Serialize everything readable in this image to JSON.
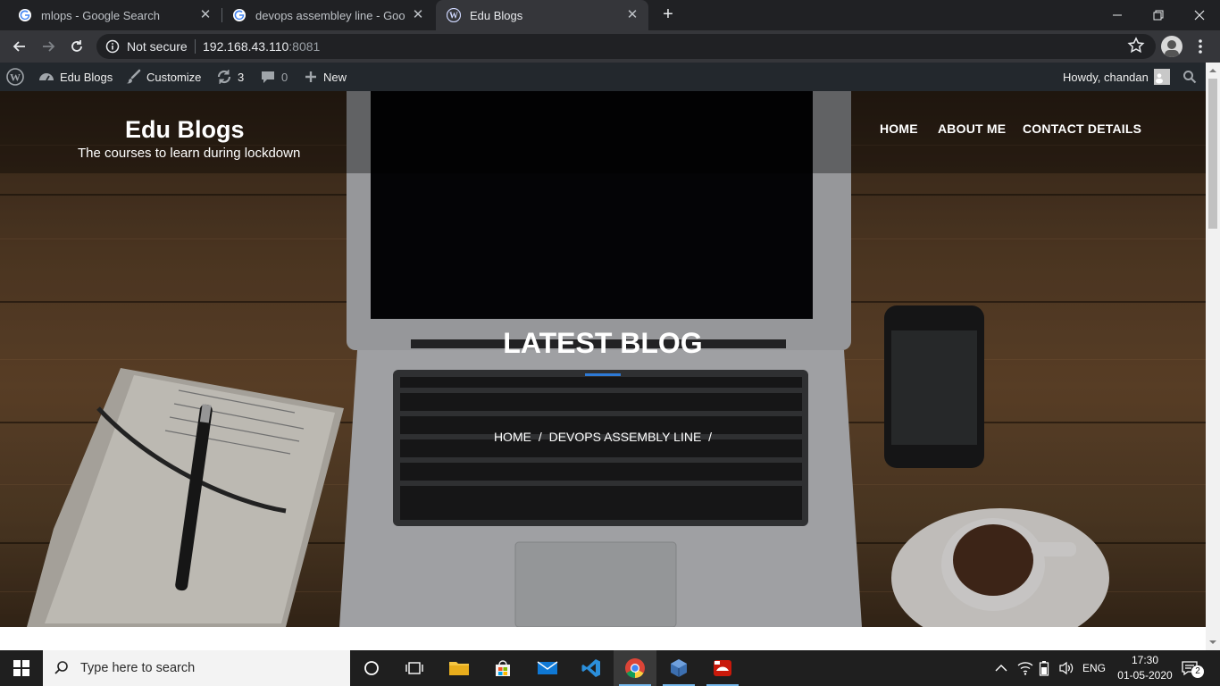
{
  "browser": {
    "tabs": [
      {
        "title": "mlops - Google Search",
        "icon": "google-icon",
        "active": false
      },
      {
        "title": "devops assembley line - Google S",
        "icon": "google-icon",
        "active": false
      },
      {
        "title": "Edu Blogs",
        "icon": "wordpress-icon",
        "active": true
      }
    ],
    "security_label": "Not secure",
    "url_host": "192.168.43.110",
    "url_port": ":8081"
  },
  "adminbar": {
    "site_name": "Edu Blogs",
    "customize": "Customize",
    "updates_count": "3",
    "comments_count": "0",
    "new_label": "New",
    "howdy": "Howdy, chandan"
  },
  "site": {
    "title": "Edu Blogs",
    "tagline": "The courses to learn during lockdown",
    "nav": [
      "HOME",
      "ABOUT ME",
      "CONTACT DETAILS"
    ],
    "hero_title": "LATEST BLOG",
    "breadcrumb": [
      "HOME",
      "/",
      "DEVOPS ASSEMBLY LINE",
      "/"
    ]
  },
  "taskbar": {
    "search_placeholder": "Type here to search",
    "language": "ENG",
    "time": "17:30",
    "date": "01-05-2020",
    "notifications": "2"
  },
  "colors": {
    "adminbar_bg": "#23282d",
    "accent_underline": "#2e7ad6",
    "taskbar_bg": "#1f1f1f"
  }
}
